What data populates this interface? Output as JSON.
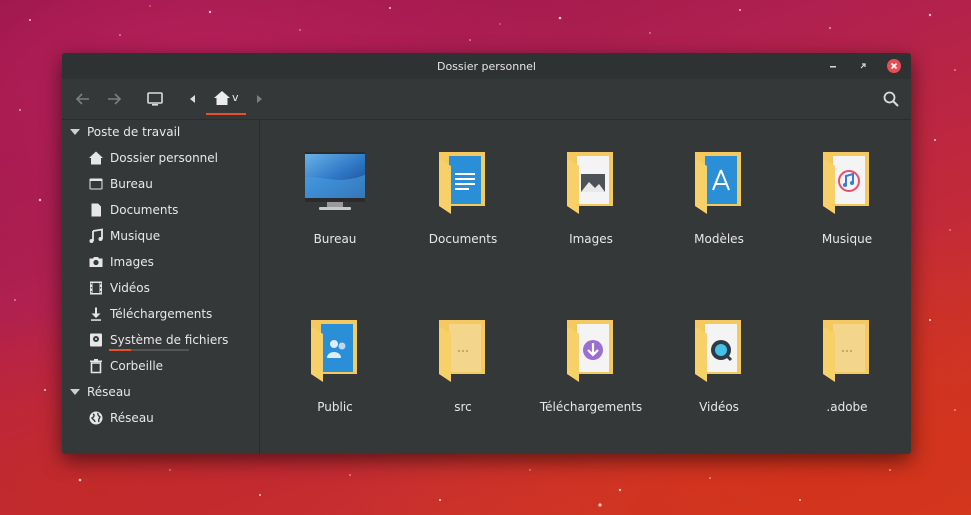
{
  "window": {
    "title": "Dossier personnel"
  },
  "toolbar": {
    "location_label": "v"
  },
  "sidebar": {
    "sections": [
      {
        "label": "Poste de travail"
      },
      {
        "label": "Réseau"
      }
    ],
    "items": [
      {
        "label": "Dossier personnel",
        "icon": "home-icon"
      },
      {
        "label": "Bureau",
        "icon": "desktop-icon"
      },
      {
        "label": "Documents",
        "icon": "document-icon"
      },
      {
        "label": "Musique",
        "icon": "music-icon"
      },
      {
        "label": "Images",
        "icon": "camera-icon"
      },
      {
        "label": "Vidéos",
        "icon": "film-icon"
      },
      {
        "label": "Téléchargements",
        "icon": "download-icon"
      },
      {
        "label": "Système de fichiers",
        "icon": "drive-icon"
      },
      {
        "label": "Corbeille",
        "icon": "trash-icon"
      },
      {
        "label": "Réseau",
        "icon": "globe-icon"
      }
    ],
    "filesystem_usage": 0.27
  },
  "files": [
    {
      "label": "Bureau",
      "icon": "monitor-icon"
    },
    {
      "label": "Documents",
      "icon": "folder-documents-icon"
    },
    {
      "label": "Images",
      "icon": "folder-images-icon"
    },
    {
      "label": "Modèles",
      "icon": "folder-templates-icon"
    },
    {
      "label": "Musique",
      "icon": "folder-music-icon"
    },
    {
      "label": "Public",
      "icon": "folder-public-icon"
    },
    {
      "label": "src",
      "icon": "folder-icon"
    },
    {
      "label": "Téléchargements",
      "icon": "folder-downloads-icon"
    },
    {
      "label": "Vidéos",
      "icon": "folder-videos-icon"
    },
    {
      "label": ".adobe",
      "icon": "folder-icon"
    }
  ],
  "colors": {
    "accent": "#e8502a",
    "close": "#e84e55",
    "folder": "#f7c75a",
    "window_bg": "#353839"
  }
}
